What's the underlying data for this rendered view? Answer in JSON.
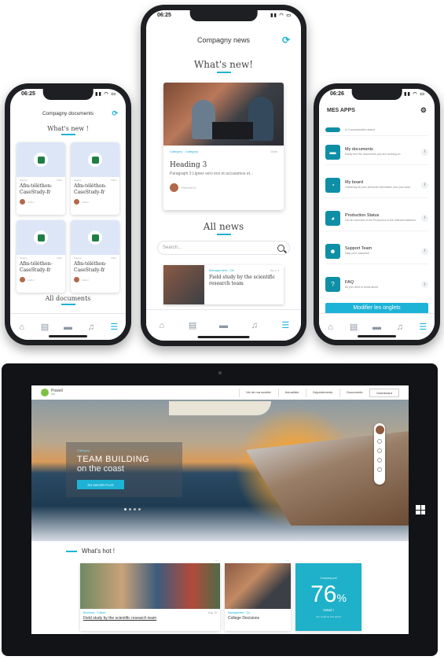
{
  "phones": {
    "documents": {
      "time": "06:25",
      "title": "Compagny documents",
      "whats_new": "What's new !",
      "cards": [
        {
          "meta_left": "Source",
          "meta_right": "Filter",
          "name": "Afm-téléthon-CaseStudy-fr",
          "author": "Author"
        },
        {
          "meta_left": "Source",
          "meta_right": "Filter",
          "name": "Afm-téléthon-CaseStudy-fr",
          "author": "Author"
        },
        {
          "meta_left": "Source",
          "meta_right": "Filter",
          "name": "Afm-téléthon-CaseStudy-fr",
          "author": "Author"
        },
        {
          "meta_left": "Source",
          "meta_right": "Filter",
          "name": "Afm-téléthon-CaseStudy-fr",
          "author": "Author"
        }
      ],
      "all_documents": "All documents"
    },
    "news": {
      "time": "06:25",
      "title": "Compagny news",
      "whats_new": "What's new!",
      "card": {
        "category": "Category · Category",
        "date": "Date",
        "heading": "Heading 3",
        "paragraph": "Paragraph 3 Lignes vero eos et accusamus et...",
        "author": "Prénom N."
      },
      "all_news": "All news",
      "search_placeholder": "Search...",
      "list_item": {
        "category": "Management · Dir",
        "date": "Au s J",
        "title": "Field study by the scientific research team"
      }
    },
    "apps": {
      "time": "06:26",
      "header": "MES APPS",
      "apps": [
        {
          "name": "",
          "desc": "& Communication teams"
        },
        {
          "name": "My documents",
          "desc": "Easily find the documents you are working on"
        },
        {
          "name": "My board",
          "desc": "Gathering all your personal information and your work"
        },
        {
          "name": "Production Status",
          "desc": "Get an overview of the Production in the different factories"
        },
        {
          "name": "Support Team",
          "desc": "Help your coworker!"
        },
        {
          "name": "FAQ",
          "desc": "All you need to know about"
        }
      ],
      "modify_button": "Modifier les onglets",
      "info_glyph": "i"
    }
  },
  "tablet": {
    "logo_name": "Powell",
    "logo_sub": "365",
    "menu": [
      "Vie de ma société",
      "Actualités",
      "Départements",
      "Documents",
      "Dashboard"
    ],
    "hero": {
      "kicker": "Category",
      "title": "TEAM BUILDING",
      "subtitle": "on the coast",
      "button": "EN SAVOIR PLUS"
    },
    "whats_hot": "What's hot !",
    "hot_cards": [
      {
        "category": "Business · Culture",
        "date": "Aug 15",
        "title": "Field study by the scientific research team"
      },
      {
        "category": "Management · Dir",
        "date": "",
        "title": "College Decisions"
      }
    ],
    "vote": {
      "label": "Company poll",
      "number": "76",
      "unit": "%",
      "sub": "Voted !",
      "foot": "You voted for this option"
    },
    "more_glyph": "···"
  },
  "colors": {
    "accent": "#1db3d6",
    "app_icon": "#0f8fa5",
    "excel": "#1e7e45",
    "vote_bg": "#1eb1c9"
  }
}
